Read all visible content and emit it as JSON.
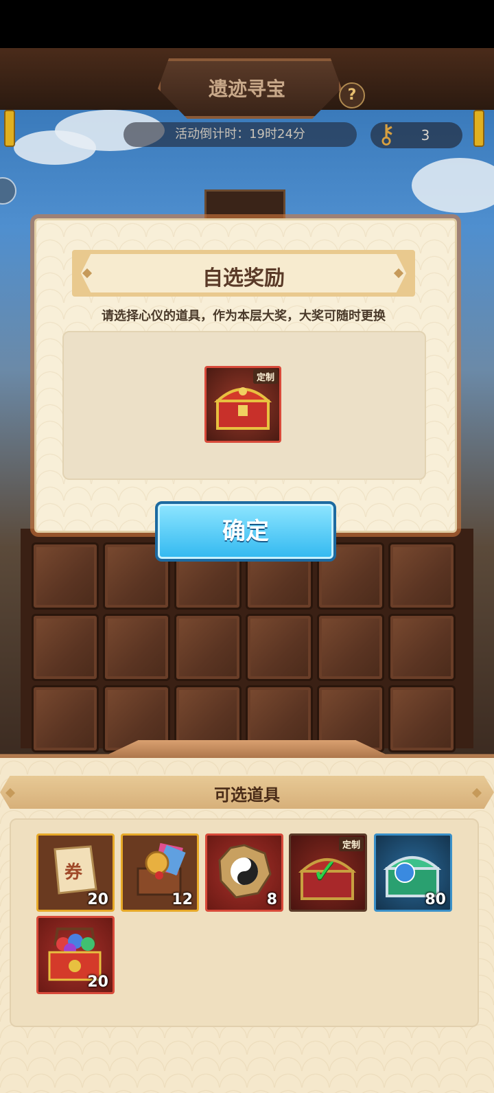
{
  "header": {
    "title": "遗迹寻宝",
    "help_label": "?",
    "countdown": "活动倒计时：19时24分",
    "key_count": "3"
  },
  "modal": {
    "title": "自选奖励",
    "description": "请选择心仪的道具，作为本层大奖，大奖可随时更换",
    "selected_item": {
      "icon": "golden-red-treasure-chest-icon",
      "tag": "定制"
    },
    "confirm_label": "确定"
  },
  "selectable_items": {
    "title": "可选道具",
    "items": [
      {
        "icon": "coupon-scroll-icon",
        "quantity": "20",
        "frame": "#e7a928",
        "bg": "#6a3a20"
      },
      {
        "icon": "coupon-gift-pack-icon",
        "quantity": "12",
        "frame": "#e7a928",
        "bg": "#6a3a20"
      },
      {
        "icon": "yin-yang-bagua-icon",
        "quantity": "8",
        "frame": "#d84a3a",
        "bg": "#8a2020"
      },
      {
        "icon": "golden-red-treasure-chest-icon",
        "tag": "定制",
        "selected": true,
        "frame": "#5a3a28",
        "bg": "#6a2a20"
      },
      {
        "icon": "jade-chest-icon",
        "quantity": "80",
        "frame": "#3a90c8",
        "bg": "#1e4a70"
      },
      {
        "icon": "gem-basket-icon",
        "quantity": "20",
        "frame": "#d84a3a",
        "bg": "#8a2020"
      }
    ]
  },
  "colors": {
    "accent_blue": "#31b8f0",
    "panel_cream": "#f8efd8",
    "title_brown": "#5a3a28"
  }
}
